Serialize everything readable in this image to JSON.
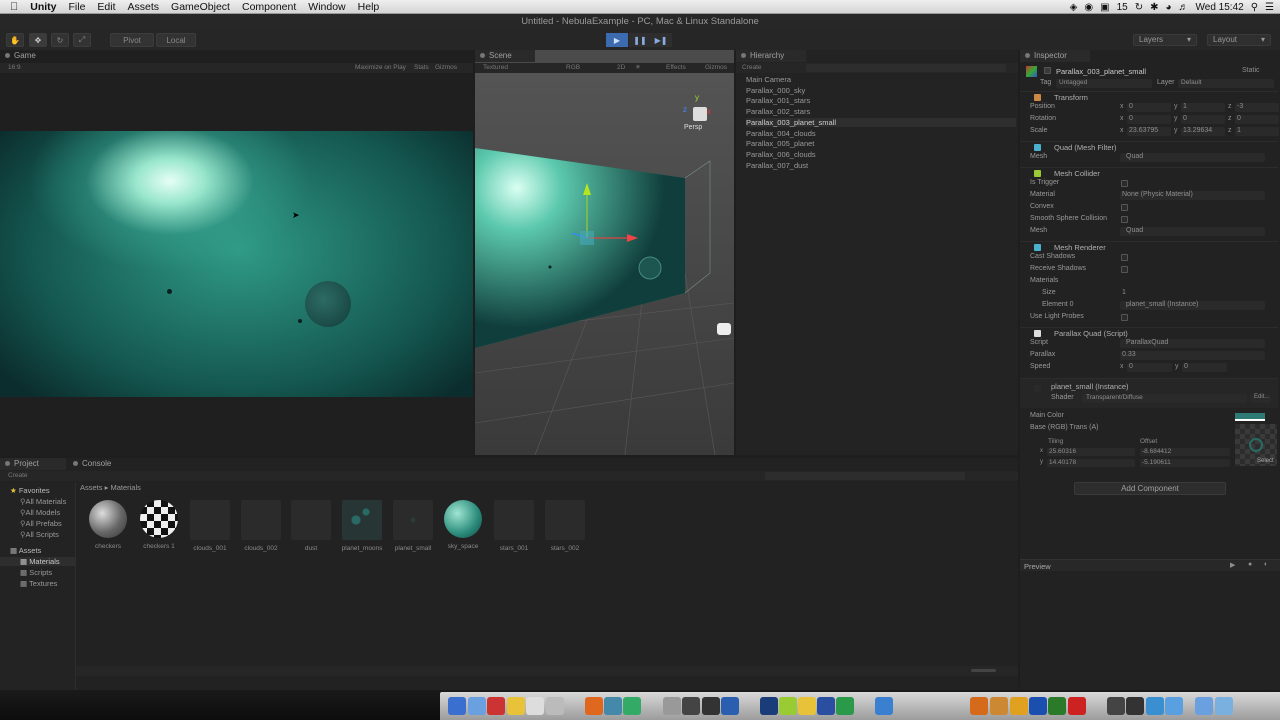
{
  "menubar": {
    "app_name": "Unity",
    "items": [
      "File",
      "Edit",
      "Assets",
      "GameObject",
      "Component",
      "Window",
      "Help"
    ],
    "battery": "15",
    "clock": "Wed 15:42"
  },
  "window_title": "Untitled - NebulaExample - PC, Mac & Linux Standalone",
  "toolbar": {
    "pivot": "Pivot",
    "local": "Local",
    "layers": "Layers",
    "layout": "Layout"
  },
  "game": {
    "tab": "Game",
    "aspect": "16:9",
    "maximize": "Maximize on Play",
    "stats": "Stats",
    "gizmos": "Gizmos"
  },
  "scene": {
    "tab": "Scene",
    "shading": "Textured",
    "rgb": "RGB",
    "mode2d": "2D",
    "effects": "Effects",
    "gizmos": "Gizmos",
    "persp": "Persp"
  },
  "hierarchy": {
    "tab": "Hierarchy",
    "create": "Create",
    "items": [
      "Main Camera",
      "Parallax_000_sky",
      "Parallax_001_stars",
      "Parallax_002_stars",
      "Parallax_003_planet_small",
      "Parallax_004_clouds",
      "Parallax_005_planet",
      "Parallax_006_clouds",
      "Parallax_007_dust"
    ],
    "selected_index": 4
  },
  "inspector": {
    "tab": "Inspector",
    "object_name": "Parallax_003_planet_small",
    "static": "Static",
    "tag_label": "Tag",
    "tag": "Untagged",
    "layer_label": "Layer",
    "layer": "Default",
    "transform": {
      "title": "Transform",
      "rows": [
        {
          "label": "Position",
          "x": "0",
          "y": "1",
          "z": "-3"
        },
        {
          "label": "Rotation",
          "x": "0",
          "y": "0",
          "z": "0"
        },
        {
          "label": "Scale",
          "x": "23.63795",
          "y": "13.29634",
          "z": "1"
        }
      ]
    },
    "mesh_filter": {
      "title": "Quad (Mesh Filter)",
      "mesh_label": "Mesh",
      "mesh": "Quad"
    },
    "mesh_collider": {
      "title": "Mesh Collider",
      "is_trigger": "Is Trigger",
      "material_label": "Material",
      "material": "None (Physic Material)",
      "convex": "Convex",
      "smooth": "Smooth Sphere Collision",
      "mesh_label": "Mesh",
      "mesh": "Quad"
    },
    "mesh_renderer": {
      "title": "Mesh Renderer",
      "cast": "Cast Shadows",
      "receive": "Receive Shadows",
      "materials": "Materials",
      "size_label": "Size",
      "size": "1",
      "element_label": "Element 0",
      "element": "planet_small (Instance)",
      "light_probes": "Use Light Probes"
    },
    "parallax": {
      "title": "Parallax Quad (Script)",
      "script_label": "Script",
      "script": "ParallaxQuad",
      "parallax_label": "Parallax",
      "parallax": "0.33",
      "speed_label": "Speed",
      "speed_x": "0",
      "speed_y": "0"
    },
    "material": {
      "title": "planet_small (Instance)",
      "shader_label": "Shader",
      "shader": "Transparent/Diffuse",
      "edit": "Edit...",
      "main_color": "Main Color",
      "base": "Base (RGB) Trans (A)",
      "tiling": "Tiling",
      "offset": "Offset",
      "tx": "25.60316",
      "ty": "14.40178",
      "ox": "-8.684412",
      "oy": "-5.190611",
      "select": "Select"
    },
    "add_component": "Add Component",
    "preview": "Preview"
  },
  "project": {
    "tab": "Project",
    "console_tab": "Console",
    "create": "Create",
    "favorites": "Favorites",
    "fav_items": [
      "All Materials",
      "All Models",
      "All Prefabs",
      "All Scripts"
    ],
    "assets_root": "Assets",
    "asset_folders": [
      "Materials",
      "Scripts",
      "Textures"
    ],
    "breadcrumb_root": "Assets",
    "breadcrumb_sep": "▸",
    "breadcrumb_leaf": "Materials",
    "assets": [
      "checkers",
      "checkers 1",
      "clouds_001",
      "clouds_002",
      "dust",
      "planet_moons",
      "planet_small",
      "sky_space",
      "stars_001",
      "stars_002"
    ]
  },
  "axes": {
    "x": "x",
    "y": "y",
    "z": "z"
  },
  "colors": {
    "accent": "#4a78b8",
    "selection": "#2e2e2e",
    "nebula": "#2fa890"
  }
}
